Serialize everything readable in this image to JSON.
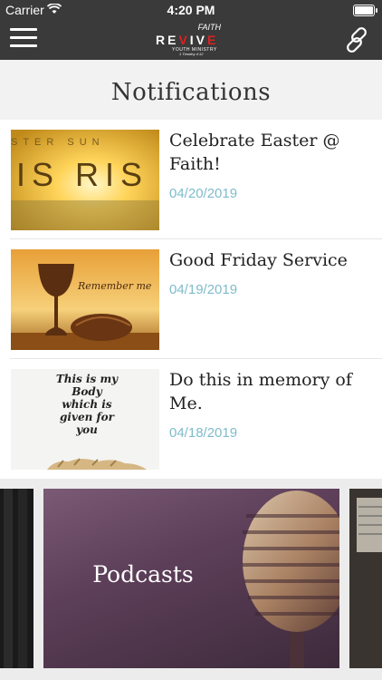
{
  "status_bar": {
    "carrier": "Carrier",
    "time": "4:20 PM"
  },
  "nav": {
    "logo": {
      "line1": "FAITH",
      "line2_a": "RE",
      "line2_b": "V",
      "line2_c": "IV",
      "line2_d": "E",
      "sub": "YOUTH MINISTRY",
      "verse": "1 Timothy 4:12"
    }
  },
  "page": {
    "title": "Notifications"
  },
  "notifications": [
    {
      "title": "Celebrate Easter @ Faith!",
      "date": "04/20/2019",
      "image_text": [
        "STER SUN",
        "IS RIS"
      ]
    },
    {
      "title": "Good Friday Service",
      "date": "04/19/2019",
      "image_text": [
        "Remember me"
      ]
    },
    {
      "title": "Do this in memory of Me.",
      "date": "04/18/2019",
      "image_text": [
        "This is my Body which is given for you"
      ]
    }
  ],
  "carousel": {
    "cards": [
      {
        "label": ""
      },
      {
        "label": "Podcasts"
      },
      {
        "label": ""
      }
    ]
  }
}
